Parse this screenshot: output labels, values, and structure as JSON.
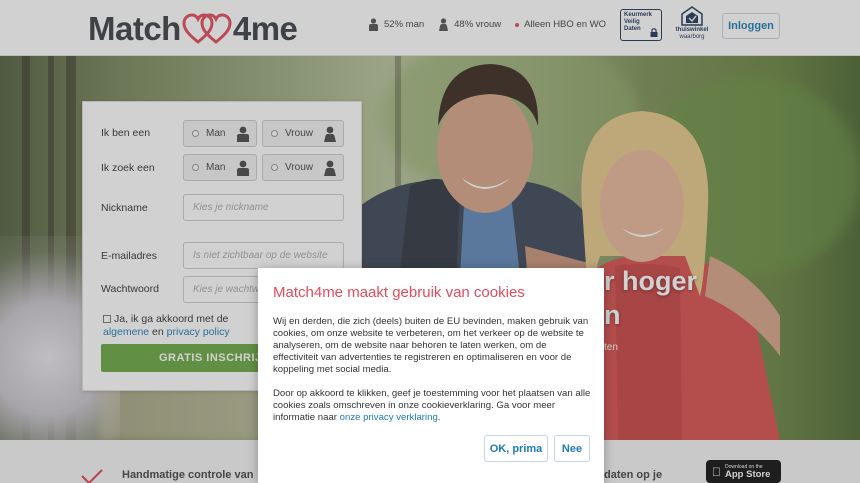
{
  "header": {
    "logo_left": "Match",
    "logo_right": "4me",
    "stats": [
      {
        "icon": "man-icon",
        "label": "52% man"
      },
      {
        "icon": "woman-icon",
        "label": "48% vrouw"
      },
      {
        "icon": "dot",
        "label": "Alleen HBO en WO"
      }
    ],
    "keurmerk": {
      "line1": "Keurmerk",
      "line2": "Veilig",
      "line3": "Daten"
    },
    "thuiswinkel": {
      "line1": "thuiswinkel",
      "line2": "waarborg"
    },
    "login_label": "Inloggen"
  },
  "hero": {
    "slogan_line1": "r hoger",
    "slogan_line2": "n",
    "slogan_line3": "ten"
  },
  "form": {
    "i_am_label": "Ik ben een",
    "seek_label": "Ik zoek een",
    "option_man": "Man",
    "option_woman": "Vrouw",
    "nickname_label": "Nickname",
    "nickname_placeholder": "Kies je nickname",
    "email_label": "E-mailadres",
    "email_placeholder": "Is niet zichtbaar op de website",
    "password_label": "Wachtwoord",
    "password_placeholder": "Kies je wachtwoord",
    "agree_prefix": "Ja, ik ga akkoord met de",
    "agree_link1": "algemene",
    "agree_mid": "en",
    "agree_link2": "privacy policy",
    "register_label": "GRATIS INSCHRIJVEN"
  },
  "bottom": {
    "feature1": "Handmatige controle van",
    "feature2": "daten op je",
    "appstore_small": "Download on the",
    "appstore_big": "App Store"
  },
  "cookie": {
    "title": "Match4me maakt gebruik van cookies",
    "paragraph1": "Wij en derden, die zich (deels) buiten de EU bevinden, maken gebruik van cookies, om onze website te verbeteren, om het verkeer op de website te analyseren, om de website naar behoren te laten werken, om de effectiviteit van advertenties te registreren en optimaliseren en voor de koppeling met social media.",
    "paragraph2": "Door op akkoord te klikken, geef je toestemming voor het plaatsen van alle cookies zoals omschreven in onze cookieverklaring. Ga voor meer informatie naar",
    "privacy_link": "onze privacy verklaring",
    "paragraph2_end": ".",
    "ok_label": "OK, prima",
    "no_label": "Nee"
  },
  "colors": {
    "brand_red": "#e24b5d",
    "link_blue": "#1c7bb5",
    "register_green": "#6aa844",
    "logo_dark": "#3b3f45"
  }
}
